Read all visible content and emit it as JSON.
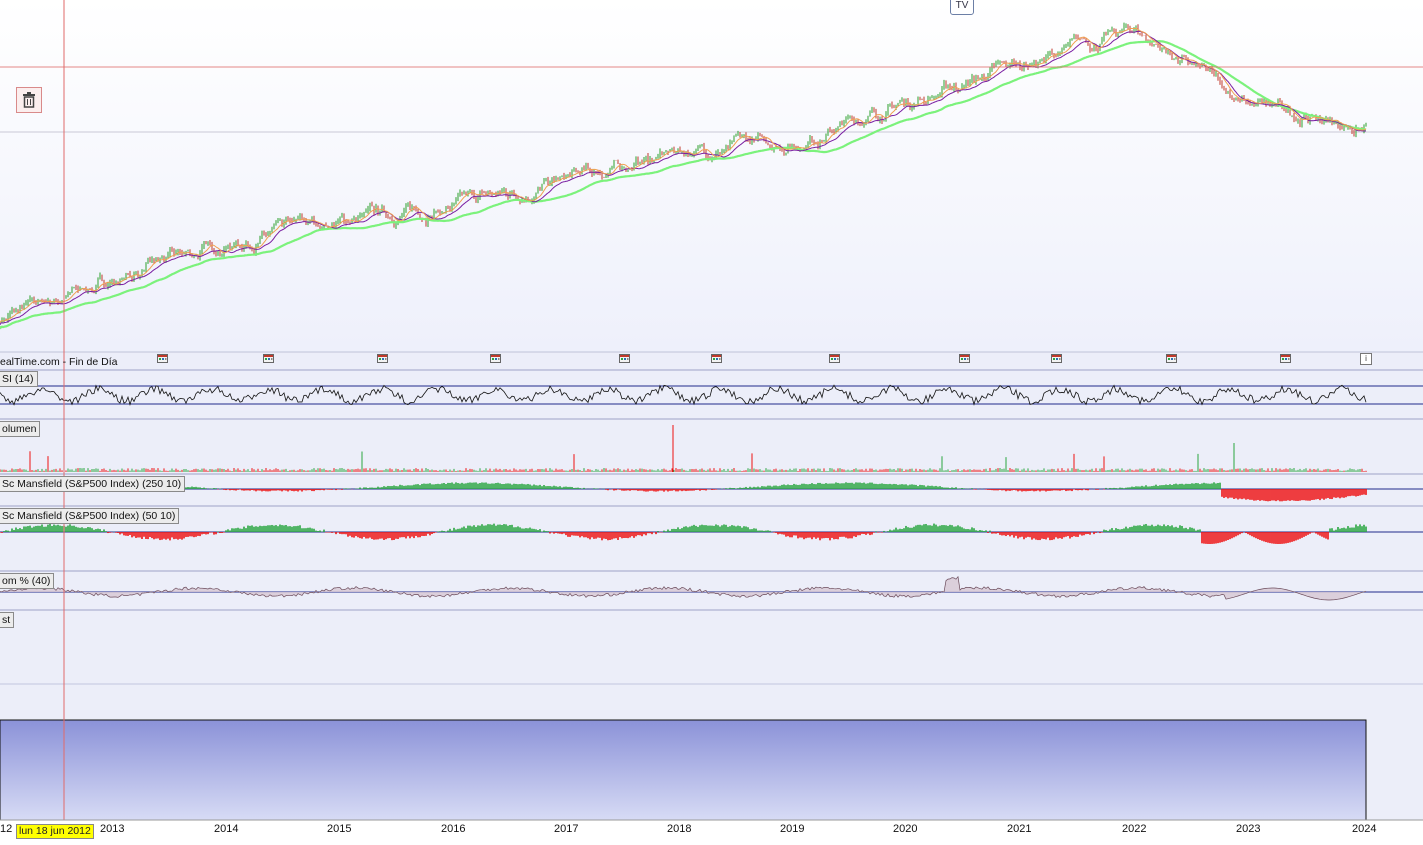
{
  "header": {
    "source_text": "ealTime.com - Fin de Día",
    "badge": "TV",
    "cursor_date": "lun 18 jun 2012"
  },
  "indicators": {
    "rsi": "SI (14)",
    "volume": "olumen",
    "mansfield_250": "Sc Mansfield (S&P500 Index) (250 10)",
    "mansfield_50": "Sc Mansfield (S&P500 Index) (50 10)",
    "mom": "om % (40)",
    "last": "st"
  },
  "x_axis": {
    "first_tick": "12",
    "years": [
      "2013",
      "2014",
      "2015",
      "2016",
      "2017",
      "2018",
      "2019",
      "2020",
      "2021",
      "2022",
      "2023",
      "2024"
    ]
  },
  "colors": {
    "price_up": "#2ca02c",
    "price_down": "#c0392b",
    "ma_green": "#7cf27c",
    "ma_purple": "#7a1fa2",
    "ma_orange": "#f0a050",
    "ma_red": "#d9605e",
    "rsi": "#111111",
    "pos_hist": "#2aa640",
    "neg_hist": "#ee1111",
    "bottom_pane_top": "#8b92d8",
    "bottom_pane_bottom": "#d7dbf5",
    "indicator_bg": "#eceef9",
    "crosshair": "#e06a6a"
  },
  "chart_data": {
    "type": "line",
    "title": "",
    "x": [
      "2012",
      "2013",
      "2014",
      "2015",
      "2016",
      "2017",
      "2018",
      "2019",
      "2020",
      "2021",
      "2022",
      "2023",
      "2024"
    ],
    "series": [
      {
        "values": [
          1.0,
          1.25,
          1.48,
          1.62,
          1.72,
          1.88,
          2.07,
          2.13,
          2.38,
          2.62,
          2.84,
          2.36,
          2.22
        ]
      }
    ],
    "ylim": [
      0.9,
      3.0
    ],
    "grid": true
  }
}
